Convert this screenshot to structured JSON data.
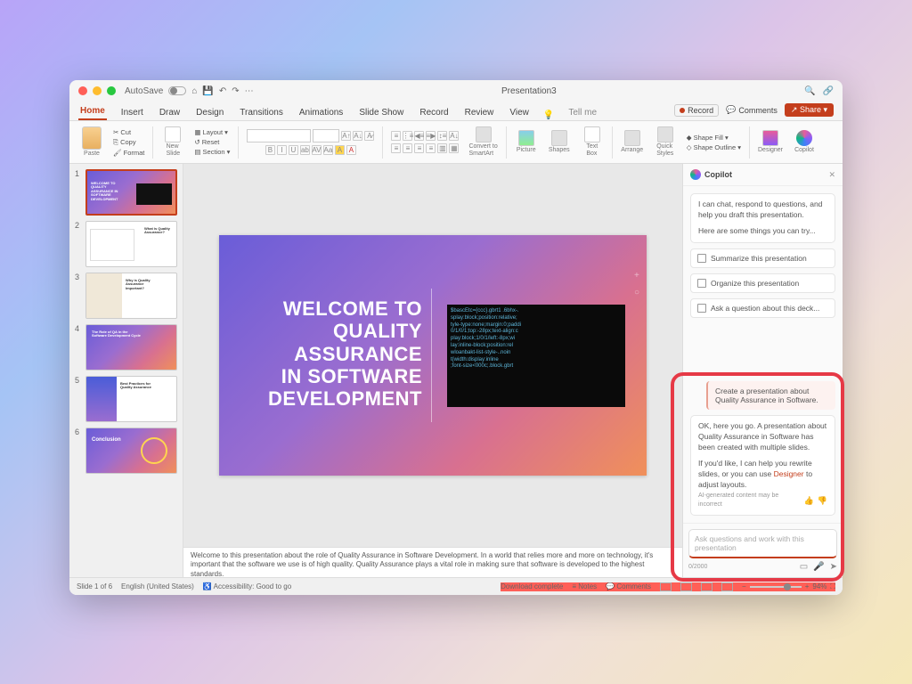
{
  "title": "Presentation3",
  "autosave": "AutoSave",
  "tabs": [
    "Home",
    "Insert",
    "Draw",
    "Design",
    "Transitions",
    "Animations",
    "Slide Show",
    "Record",
    "Review",
    "View"
  ],
  "tellme": "Tell me",
  "topright": {
    "record": "Record",
    "comments": "Comments",
    "share": "Share"
  },
  "ribbon": {
    "paste": "Paste",
    "cut": "Cut",
    "copy": "Copy",
    "format": "Format",
    "newslide": "New\nSlide",
    "layout": "Layout",
    "reset": "Reset",
    "section": "Section",
    "convert": "Convert to\nSmartArt",
    "picture": "Picture",
    "shapes": "Shapes",
    "textbox": "Text\nBox",
    "arrange": "Arrange",
    "quickstyles": "Quick\nStyles",
    "shapefill": "Shape Fill",
    "shapeoutline": "Shape Outline",
    "designer": "Designer",
    "copilot": "Copilot"
  },
  "thumbs": [
    {
      "n": "1",
      "title": "WELCOME TO QUALITY ASSURANCE IN SOFTWARE DEVELOPMENT"
    },
    {
      "n": "2",
      "title": "What is Quality Assurance?"
    },
    {
      "n": "3",
      "title": "Why is Quality Assurance Important?"
    },
    {
      "n": "4",
      "title": "The Role of QA in the Software Development Cycle"
    },
    {
      "n": "5",
      "title": "Best Practices for Quality Assurance"
    },
    {
      "n": "6",
      "title": "Conclusion"
    }
  ],
  "slide": {
    "title": "WELCOME TO\nQUALITY\nASSURANCE\nIN SOFTWARE\nDEVELOPMENT"
  },
  "notes": "Welcome to this presentation about the role of Quality Assurance in Software Development. In a world that relies more and more on technology, it's important that the software we use is of high quality. Quality Assurance plays a vital role in making sure that software is developed to the highest standards.",
  "copilot": {
    "header": "Copilot",
    "intro": "I can chat, respond to questions, and help you draft this presentation.",
    "try": "Here are some things you can try...",
    "sug": [
      "Summarize this presentation",
      "Organize this presentation",
      "Ask a question about this deck..."
    ],
    "userMsg": "Create a presentation about Quality Assurance in Software.",
    "resp1": "OK, here you go. A presentation about Quality Assurance in Software has been created with multiple slides.",
    "resp2a": "If you'd like, I can help you rewrite slides, or you can use ",
    "resp2link": "Designer",
    "resp2b": " to adjust layouts.",
    "disclaimer": "AI-generated content may be incorrect",
    "placeholder": "Ask questions and work with this presentation",
    "counter": "0/2000"
  },
  "status": {
    "slide": "Slide 1 of 6",
    "lang": "English (United States)",
    "access": "Accessibility: Good to go",
    "download": "Download complete",
    "notes": "Notes",
    "comments": "Comments",
    "zoom": "94%"
  }
}
